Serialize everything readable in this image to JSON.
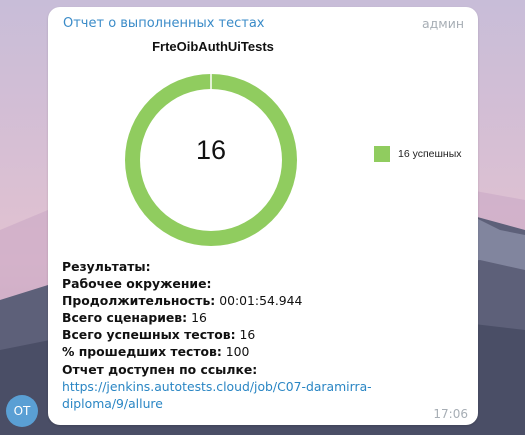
{
  "message": {
    "sender": "Отчет о выполненных тестах",
    "role": "админ",
    "time": "17:06"
  },
  "avatar": {
    "initials": "ОТ",
    "color": "#5a9fd4"
  },
  "chart_data": {
    "type": "pie",
    "title": "FrteOibAuthUiTests",
    "center_label": "16",
    "slices": [
      {
        "label": "16 успешных",
        "value": 16,
        "color": "#90cc5f"
      }
    ],
    "legend_position": "right"
  },
  "report": {
    "results_label": "Результаты:",
    "environment_label": "Рабочее окружение:",
    "duration_label": "Продолжительность:",
    "duration_value": "00:01:54.944",
    "scenarios_label": "Всего сценариев:",
    "scenarios_value": "16",
    "passed_label": "Всего успешных тестов:",
    "passed_value": "16",
    "percent_label": "% прошедших тестов:",
    "percent_value": "100",
    "link_label": "Отчет доступен по ссылке:",
    "link_line1": "https://jenkins.autotests.cloud/job/C07-daramirra-",
    "link_line2": "diploma/9/allure"
  }
}
